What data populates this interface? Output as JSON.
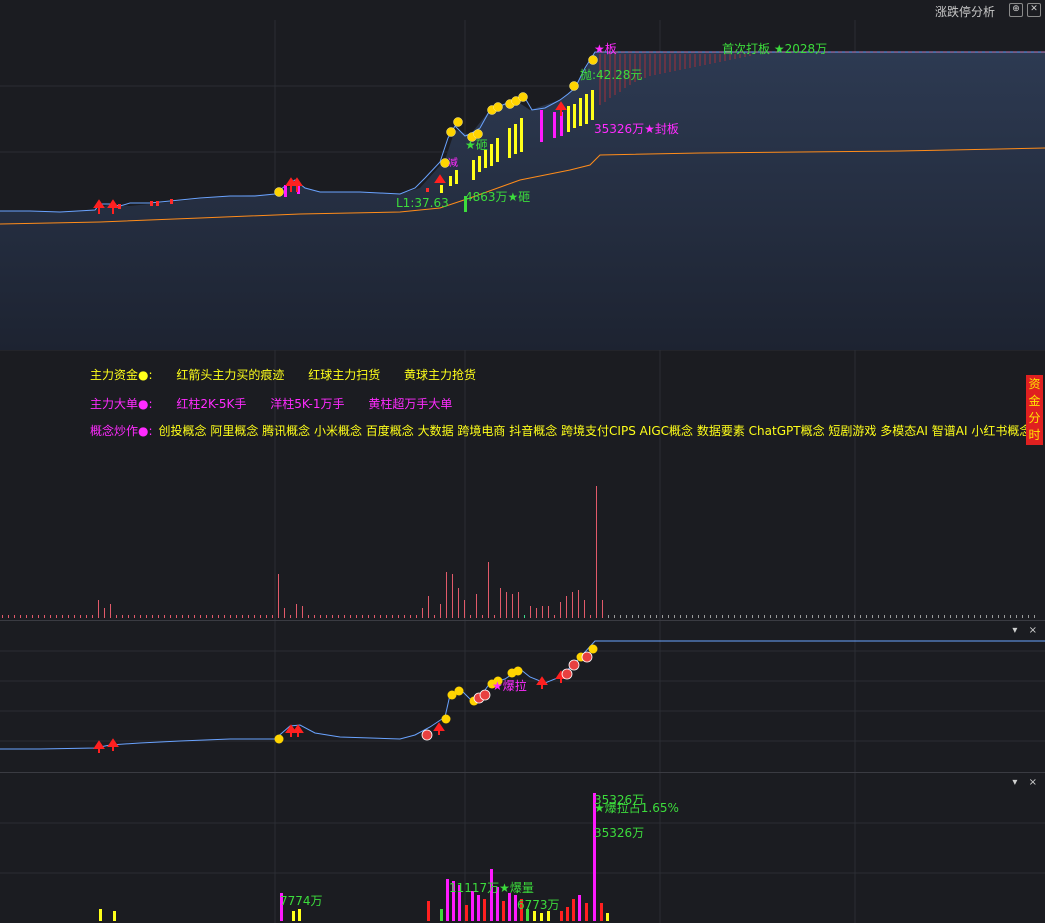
{
  "toolbar": {
    "title": "涨跌停分析",
    "btn1": "⊕",
    "btn2": "✕"
  },
  "main_chart": {
    "labels": {
      "limit_up": "★板",
      "first_limit": "首次打板 ★2028万",
      "sell": "抛:42.28元",
      "seal": "35326万★封板",
      "smash": "★砸",
      "smash_amount": "4863万★砸",
      "low": "L1:37.63",
      "small": "减"
    },
    "colors": {
      "price_line": "#6aa3ff",
      "ma_line": "#ff8c1a",
      "label_green": "#3cdc3c",
      "label_magenta": "#ff2bff",
      "ball": "#ffd400"
    }
  },
  "legend": {
    "row1": {
      "prefix": "主力资金●:",
      "items": [
        "红箭头主力买的痕迹",
        "红球主力扫货",
        "黄球主力抢货"
      ]
    },
    "row2": {
      "prefix": "主力大单●:",
      "items": [
        "红柱2K-5K手",
        "洋柱5K-1万手",
        "黄柱超万手大单"
      ]
    },
    "row3": {
      "prefix": "概念炒作●:",
      "text": "创投概念 阿里概念 腾讯概念 小米概念 百度概念 大数据 跨境电商 抖音概念 跨境支付CIPS AIGC概念 数据要素 ChatGPT概念 短剧游戏 多模态AI 智谱AI 小红书概念"
    }
  },
  "side_tag": {
    "chars": [
      "资",
      "金",
      "分",
      "时"
    ]
  },
  "pane_controls": {
    "collapse": "▾",
    "close": "×"
  },
  "indicator1": {
    "label": "★爆拉"
  },
  "indicator2": {
    "labels": {
      "peak_top": "35326万",
      "peak_pct": "★爆拉占1.65%",
      "peak_mid": "35326万",
      "left": "7774万",
      "mid": "11117万★爆量",
      "right": "6773万"
    }
  }
}
